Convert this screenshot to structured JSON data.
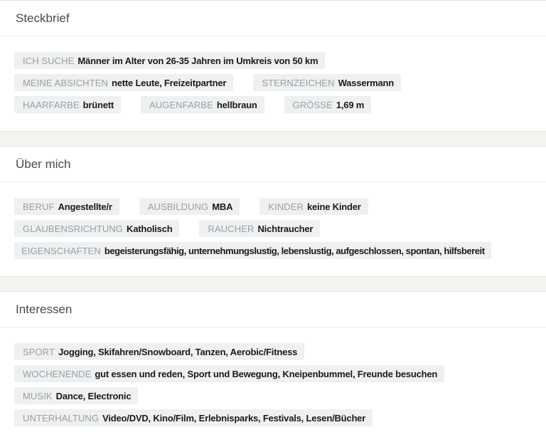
{
  "steckbrief": {
    "title": "Steckbrief",
    "rows": [
      [
        {
          "label": "ICH SUCHE",
          "value": "Männer im Alter von 26-35 Jahren im Umkreis von 50 km"
        }
      ],
      [
        {
          "label": "MEINE ABSICHTEN",
          "value": "nette Leute, Freizeitpartner"
        },
        {
          "label": "STERNZEICHEN",
          "value": "Wassermann"
        }
      ],
      [
        {
          "label": "HAARFARBE",
          "value": "brünett"
        },
        {
          "label": "AUGENFARBE",
          "value": "hellbraun"
        },
        {
          "label": "GRÖSSE",
          "value": "1,69 m"
        }
      ]
    ]
  },
  "ueber_mich": {
    "title": "Über mich",
    "rows": [
      [
        {
          "label": "BERUF",
          "value": "Angestellte/r"
        },
        {
          "label": "AUSBILDUNG",
          "value": "MBA"
        },
        {
          "label": "KINDER",
          "value": "keine Kinder"
        }
      ],
      [
        {
          "label": "GLAUBENSRICHTUNG",
          "value": "Katholisch"
        },
        {
          "label": "RAUCHER",
          "value": "Nichtraucher"
        }
      ],
      [
        {
          "label": "EIGENSCHAFTEN",
          "value": "begeisterungsfähig, unternehmungslustig, lebenslustig, aufgeschlossen, spontan, hilfsbereit"
        }
      ]
    ]
  },
  "interessen": {
    "title": "Interessen",
    "rows": [
      [
        {
          "label": "SPORT",
          "value": "Jogging, Skifahren/Snowboard, Tanzen, Aerobic/Fitness"
        }
      ],
      [
        {
          "label": "WOCHENENDE",
          "value": "gut essen und reden, Sport und Bewegung, Kneipenbummel, Freunde besuchen"
        }
      ],
      [
        {
          "label": "MUSIK",
          "value": "Dance, Electronic"
        }
      ],
      [
        {
          "label": "UNTERHALTUNG",
          "value": "Video/DVD, Kino/Film, Erlebnisparks, Festivals, Lesen/Bücher"
        }
      ]
    ]
  }
}
